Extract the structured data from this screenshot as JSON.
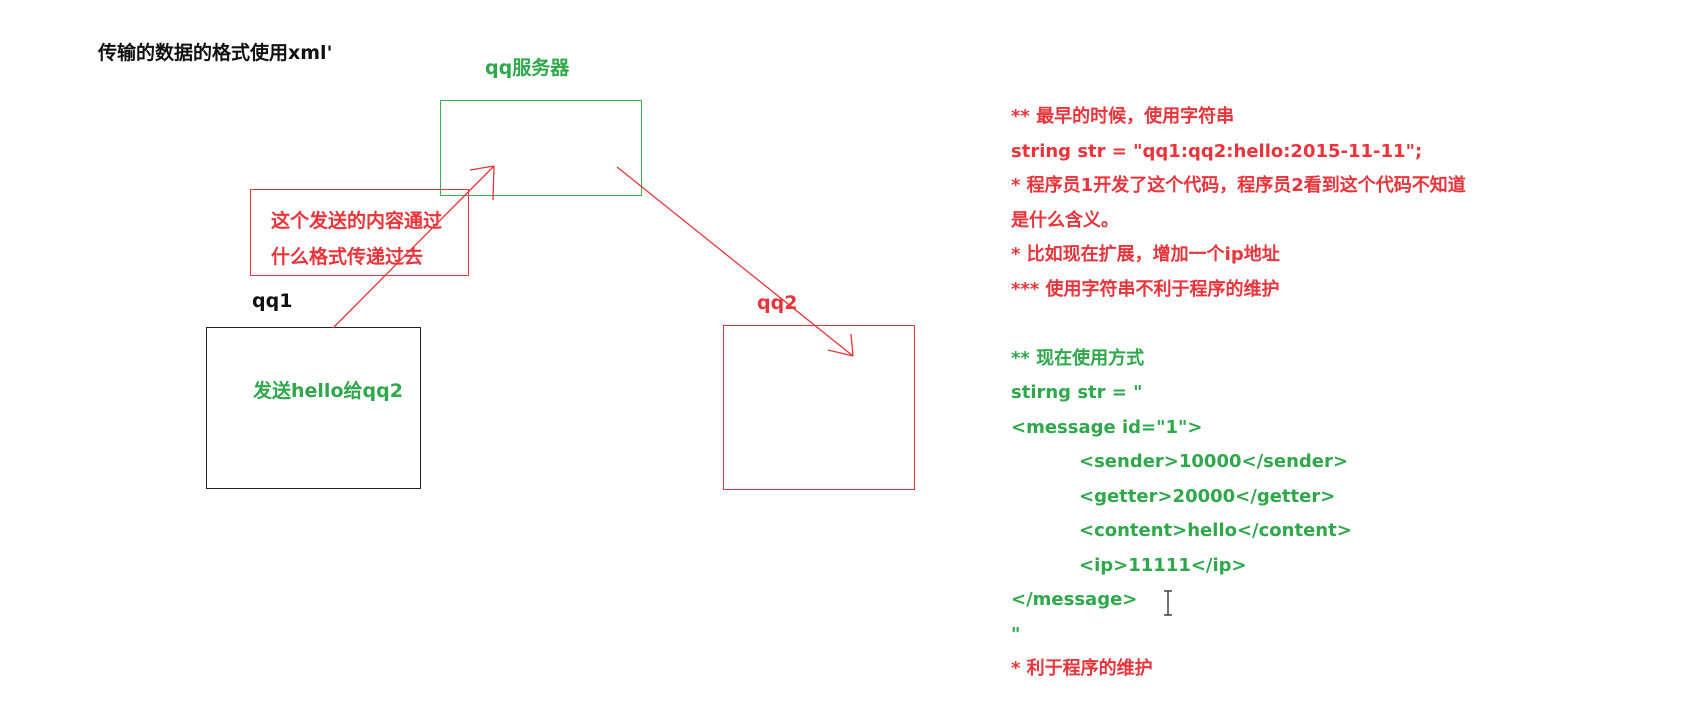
{
  "title": "传输的数据的格式使用xml'",
  "diagram": {
    "server_label": "qq服务器",
    "qq1_label": "qq1",
    "qq2_label": "qq2",
    "qq1_content": "发送hello给qq2",
    "note_lines": [
      "这个发送的内容通过",
      "什么格式传递过去"
    ]
  },
  "notes": {
    "red_lines": [
      "** 最早的时候，使用字符串",
      "string str = \"qq1:qq2:hello:2015-11-11\";",
      "* 程序员1开发了这个代码，程序员2看到这个代码不知道",
      "是什么含义。",
      "* 比如现在扩展，增加一个ip地址",
      "*** 使用字符串不利于程序的维护"
    ],
    "green_lines": [
      "** 现在使用方式",
      "stirng str = \"",
      "<message id=\"1\">",
      "<sender>10000</sender>",
      "<getter>20000</getter>",
      "<content>hello</content>",
      "<ip>11111</ip>",
      "</message>",
      "\"",
      "* 利于程序的维护"
    ]
  },
  "colors": {
    "red": "#e8343a",
    "green": "#2ea84a",
    "black": "#111111"
  },
  "icons": [
    "text-cursor-icon"
  ]
}
